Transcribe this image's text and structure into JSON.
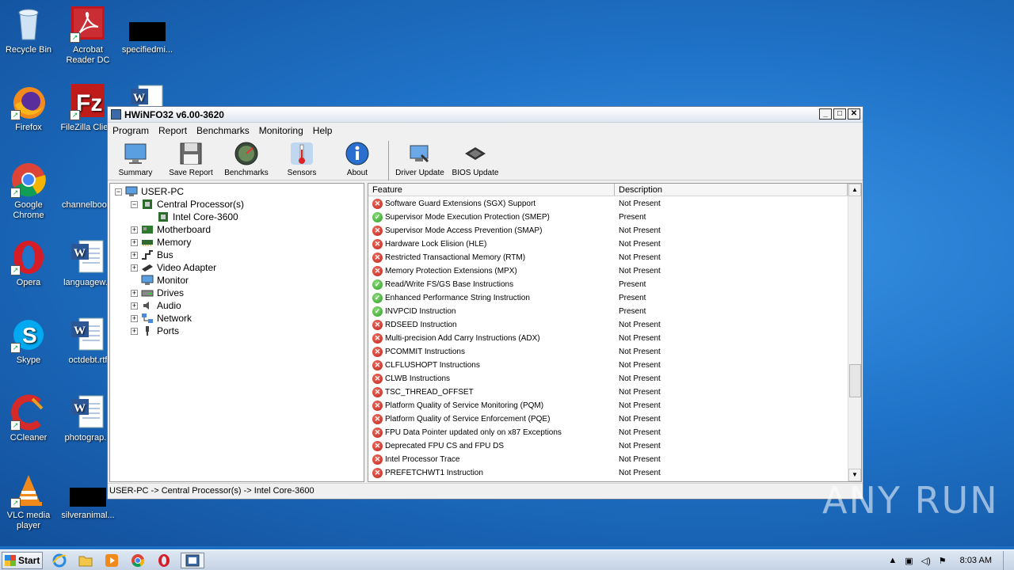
{
  "desktop": {
    "icons": [
      {
        "label": "Recycle Bin"
      },
      {
        "label": "Acrobat Reader DC"
      },
      {
        "label": "specifiedmi..."
      },
      {
        "label": "Firefox"
      },
      {
        "label": "FileZilla Clie..."
      },
      {
        "label": "Google Chrome"
      },
      {
        "label": "channelboo..."
      },
      {
        "label": "Opera"
      },
      {
        "label": "languagew..."
      },
      {
        "label": "Skype"
      },
      {
        "label": "octdebt.rtf"
      },
      {
        "label": "CCleaner"
      },
      {
        "label": "photograp..."
      },
      {
        "label": "VLC media player"
      },
      {
        "label": "silveranimal..."
      }
    ]
  },
  "window": {
    "title": "HWiNFO32 v6.00-3620",
    "menu": [
      "Program",
      "Report",
      "Benchmarks",
      "Monitoring",
      "Help"
    ],
    "toolbar": [
      "Summary",
      "Save Report",
      "Benchmarks",
      "Sensors",
      "About",
      "Driver Update",
      "BIOS Update"
    ],
    "tree": {
      "root": "USER-PC",
      "cpu": "Central Processor(s)",
      "cpu_child": "Intel Core-3600",
      "items": [
        "Motherboard",
        "Memory",
        "Bus",
        "Video Adapter",
        "Monitor",
        "Drives",
        "Audio",
        "Network",
        "Ports"
      ]
    },
    "list": {
      "col_feature": "Feature",
      "col_description": "Description",
      "rows": [
        {
          "feature": "Software Guard Extensions (SGX) Support",
          "desc": "Not Present",
          "ok": false
        },
        {
          "feature": "Supervisor Mode Execution Protection (SMEP)",
          "desc": "Present",
          "ok": true
        },
        {
          "feature": "Supervisor Mode Access Prevention (SMAP)",
          "desc": "Not Present",
          "ok": false
        },
        {
          "feature": "Hardware Lock Elision (HLE)",
          "desc": "Not Present",
          "ok": false
        },
        {
          "feature": "Restricted Transactional Memory (RTM)",
          "desc": "Not Present",
          "ok": false
        },
        {
          "feature": "Memory Protection Extensions (MPX)",
          "desc": "Not Present",
          "ok": false
        },
        {
          "feature": "Read/Write FS/GS Base Instructions",
          "desc": "Present",
          "ok": true
        },
        {
          "feature": "Enhanced Performance String Instruction",
          "desc": "Present",
          "ok": true
        },
        {
          "feature": "INVPCID Instruction",
          "desc": "Present",
          "ok": true
        },
        {
          "feature": "RDSEED Instruction",
          "desc": "Not Present",
          "ok": false
        },
        {
          "feature": "Multi-precision Add Carry Instructions (ADX)",
          "desc": "Not Present",
          "ok": false
        },
        {
          "feature": "PCOMMIT Instructions",
          "desc": "Not Present",
          "ok": false
        },
        {
          "feature": "CLFLUSHOPT Instructions",
          "desc": "Not Present",
          "ok": false
        },
        {
          "feature": "CLWB Instructions",
          "desc": "Not Present",
          "ok": false
        },
        {
          "feature": "TSC_THREAD_OFFSET",
          "desc": "Not Present",
          "ok": false
        },
        {
          "feature": "Platform Quality of Service Monitoring (PQM)",
          "desc": "Not Present",
          "ok": false
        },
        {
          "feature": "Platform Quality of Service Enforcement (PQE)",
          "desc": "Not Present",
          "ok": false
        },
        {
          "feature": "FPU Data Pointer updated only on x87 Exceptions",
          "desc": "Not Present",
          "ok": false
        },
        {
          "feature": "Deprecated FPU CS and FPU DS",
          "desc": "Not Present",
          "ok": false
        },
        {
          "feature": "Intel Processor Trace",
          "desc": "Not Present",
          "ok": false
        },
        {
          "feature": "PREFETCHWT1 Instruction",
          "desc": "Not Present",
          "ok": false
        }
      ]
    },
    "status": "USER-PC -> Central Processor(s) -> Intel Core-3600"
  },
  "watermark": "ANY RUN",
  "taskbar": {
    "start_label": "Start",
    "clock": "8:03 AM"
  }
}
